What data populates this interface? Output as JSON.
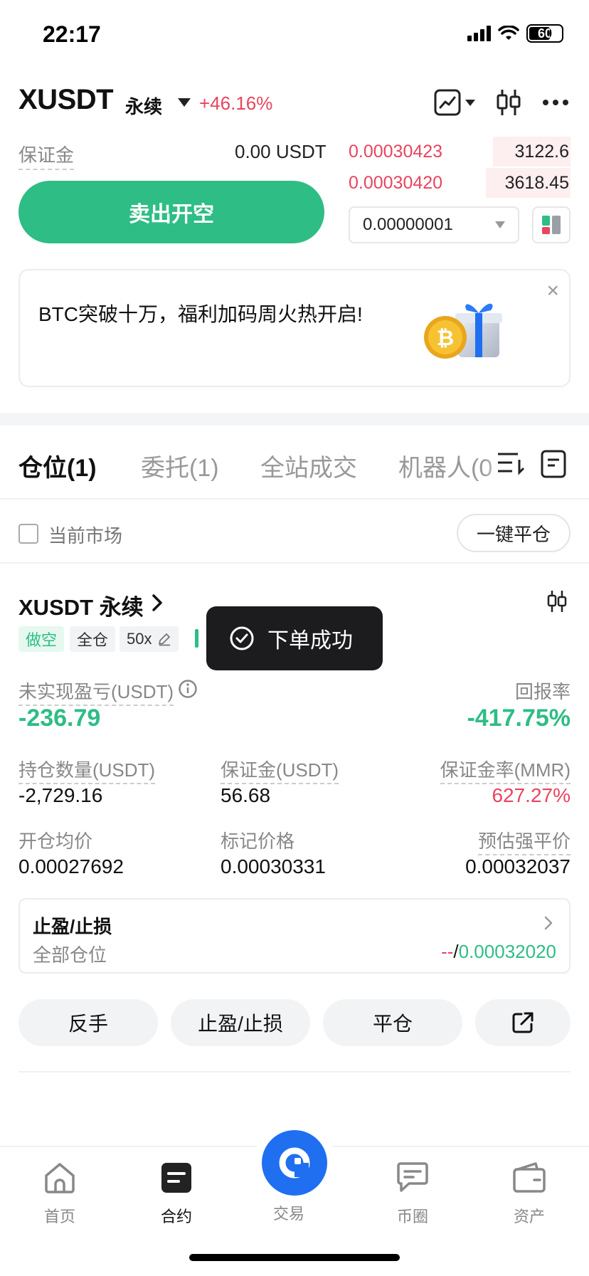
{
  "status_bar": {
    "time": "22:17",
    "battery": "60"
  },
  "header": {
    "pair": "XUSDT",
    "contract_type": "永续",
    "change": "+46.16%"
  },
  "form": {
    "margin_label": "保证金",
    "margin_value": "0.00 USDT",
    "sell_button": "卖出开空",
    "precision": "0.00000001"
  },
  "orderbook": [
    {
      "price": "0.00030423",
      "qty": "3122.6",
      "depth": 0.35
    },
    {
      "price": "0.00030420",
      "qty": "3618.45",
      "depth": 0.38
    }
  ],
  "banner": {
    "text": "BTC突破十万，福利加码周火热开启!",
    "close": "×"
  },
  "tabs": [
    "仓位(1)",
    "委托(1)",
    "全站成交",
    "机器人(0"
  ],
  "filter": {
    "current_market": "当前市场",
    "close_all": "一键平仓"
  },
  "position": {
    "title": "XUSDT 永续",
    "tags": {
      "side": "做空",
      "margin_mode": "全仓",
      "leverage": "50x"
    },
    "toast": "下单成功",
    "pnl_label": "未实现盈亏(USDT)",
    "pnl_value": "-236.79",
    "roe_label": "回报率",
    "roe_value": "-417.75%",
    "size_label": "持仓数量(USDT)",
    "size_value": "-2,729.16",
    "margin_label": "保证金(USDT)",
    "margin_value": "56.68",
    "mmr_label": "保证金率(MMR)",
    "mmr_value": "627.27%",
    "entry_label": "开仓均价",
    "entry_value": "0.00027692",
    "mark_label": "标记价格",
    "mark_value": "0.00030331",
    "liq_label": "预估强平价",
    "liq_value": "0.00032037",
    "tpsl_title": "止盈/止损",
    "tpsl_scope": "全部仓位",
    "tpsl_tp": "--",
    "tpsl_sep": "/",
    "tpsl_sl": "0.00032020",
    "actions": {
      "reverse": "反手",
      "tpsl": "止盈/止损",
      "close": "平仓"
    }
  },
  "tabbar": {
    "home": "首页",
    "contract": "合约",
    "trade": "交易",
    "community": "币圈",
    "assets": "资产"
  },
  "colors": {
    "green": "#2ebd85",
    "red": "#e8455f",
    "blue": "#1f6ff0"
  }
}
